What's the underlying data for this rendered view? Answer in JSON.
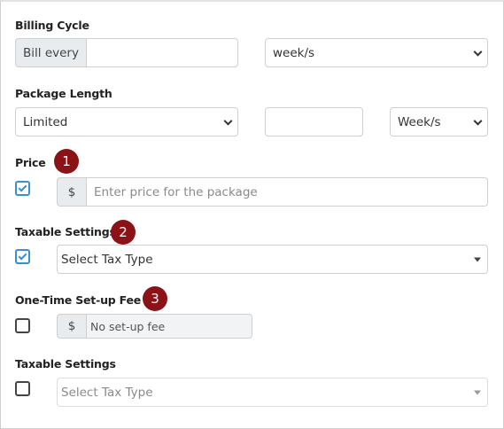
{
  "billing_cycle": {
    "label": "Billing Cycle",
    "prefix": "Bill every",
    "value": "",
    "unit": "week/s"
  },
  "package_length": {
    "label": "Package Length",
    "type": "Limited",
    "value": "",
    "unit": "Week/s"
  },
  "price": {
    "label": "Price",
    "badge": "1",
    "checked": true,
    "currency": "$",
    "placeholder": "Enter price for the package"
  },
  "taxable_settings_1": {
    "label": "Taxable Settings",
    "badge": "2",
    "checked": true,
    "value": "Select Tax Type"
  },
  "setup_fee": {
    "label": "One-Time Set-up Fee",
    "badge": "3",
    "checked": false,
    "currency": "$",
    "placeholder": "No set-up fee"
  },
  "taxable_settings_2": {
    "label": "Taxable Settings",
    "checked": false,
    "value": "Select Tax Type"
  },
  "colors": {
    "badge": "#8b1318",
    "check_accent": "#3a8fd1",
    "addon_bg": "#e9ecef"
  }
}
